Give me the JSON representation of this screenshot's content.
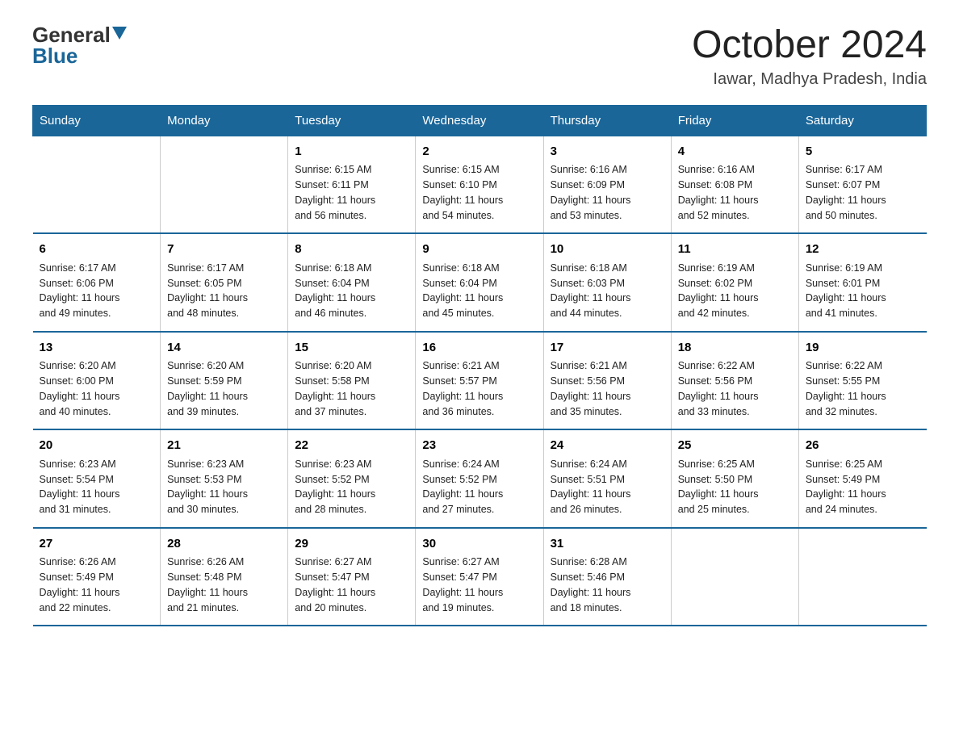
{
  "logo": {
    "general": "General",
    "blue": "Blue"
  },
  "title": "October 2024",
  "location": "Iawar, Madhya Pradesh, India",
  "days_of_week": [
    "Sunday",
    "Monday",
    "Tuesday",
    "Wednesday",
    "Thursday",
    "Friday",
    "Saturday"
  ],
  "weeks": [
    [
      {
        "day": "",
        "info": ""
      },
      {
        "day": "",
        "info": ""
      },
      {
        "day": "1",
        "info": "Sunrise: 6:15 AM\nSunset: 6:11 PM\nDaylight: 11 hours\nand 56 minutes."
      },
      {
        "day": "2",
        "info": "Sunrise: 6:15 AM\nSunset: 6:10 PM\nDaylight: 11 hours\nand 54 minutes."
      },
      {
        "day": "3",
        "info": "Sunrise: 6:16 AM\nSunset: 6:09 PM\nDaylight: 11 hours\nand 53 minutes."
      },
      {
        "day": "4",
        "info": "Sunrise: 6:16 AM\nSunset: 6:08 PM\nDaylight: 11 hours\nand 52 minutes."
      },
      {
        "day": "5",
        "info": "Sunrise: 6:17 AM\nSunset: 6:07 PM\nDaylight: 11 hours\nand 50 minutes."
      }
    ],
    [
      {
        "day": "6",
        "info": "Sunrise: 6:17 AM\nSunset: 6:06 PM\nDaylight: 11 hours\nand 49 minutes."
      },
      {
        "day": "7",
        "info": "Sunrise: 6:17 AM\nSunset: 6:05 PM\nDaylight: 11 hours\nand 48 minutes."
      },
      {
        "day": "8",
        "info": "Sunrise: 6:18 AM\nSunset: 6:04 PM\nDaylight: 11 hours\nand 46 minutes."
      },
      {
        "day": "9",
        "info": "Sunrise: 6:18 AM\nSunset: 6:04 PM\nDaylight: 11 hours\nand 45 minutes."
      },
      {
        "day": "10",
        "info": "Sunrise: 6:18 AM\nSunset: 6:03 PM\nDaylight: 11 hours\nand 44 minutes."
      },
      {
        "day": "11",
        "info": "Sunrise: 6:19 AM\nSunset: 6:02 PM\nDaylight: 11 hours\nand 42 minutes."
      },
      {
        "day": "12",
        "info": "Sunrise: 6:19 AM\nSunset: 6:01 PM\nDaylight: 11 hours\nand 41 minutes."
      }
    ],
    [
      {
        "day": "13",
        "info": "Sunrise: 6:20 AM\nSunset: 6:00 PM\nDaylight: 11 hours\nand 40 minutes."
      },
      {
        "day": "14",
        "info": "Sunrise: 6:20 AM\nSunset: 5:59 PM\nDaylight: 11 hours\nand 39 minutes."
      },
      {
        "day": "15",
        "info": "Sunrise: 6:20 AM\nSunset: 5:58 PM\nDaylight: 11 hours\nand 37 minutes."
      },
      {
        "day": "16",
        "info": "Sunrise: 6:21 AM\nSunset: 5:57 PM\nDaylight: 11 hours\nand 36 minutes."
      },
      {
        "day": "17",
        "info": "Sunrise: 6:21 AM\nSunset: 5:56 PM\nDaylight: 11 hours\nand 35 minutes."
      },
      {
        "day": "18",
        "info": "Sunrise: 6:22 AM\nSunset: 5:56 PM\nDaylight: 11 hours\nand 33 minutes."
      },
      {
        "day": "19",
        "info": "Sunrise: 6:22 AM\nSunset: 5:55 PM\nDaylight: 11 hours\nand 32 minutes."
      }
    ],
    [
      {
        "day": "20",
        "info": "Sunrise: 6:23 AM\nSunset: 5:54 PM\nDaylight: 11 hours\nand 31 minutes."
      },
      {
        "day": "21",
        "info": "Sunrise: 6:23 AM\nSunset: 5:53 PM\nDaylight: 11 hours\nand 30 minutes."
      },
      {
        "day": "22",
        "info": "Sunrise: 6:23 AM\nSunset: 5:52 PM\nDaylight: 11 hours\nand 28 minutes."
      },
      {
        "day": "23",
        "info": "Sunrise: 6:24 AM\nSunset: 5:52 PM\nDaylight: 11 hours\nand 27 minutes."
      },
      {
        "day": "24",
        "info": "Sunrise: 6:24 AM\nSunset: 5:51 PM\nDaylight: 11 hours\nand 26 minutes."
      },
      {
        "day": "25",
        "info": "Sunrise: 6:25 AM\nSunset: 5:50 PM\nDaylight: 11 hours\nand 25 minutes."
      },
      {
        "day": "26",
        "info": "Sunrise: 6:25 AM\nSunset: 5:49 PM\nDaylight: 11 hours\nand 24 minutes."
      }
    ],
    [
      {
        "day": "27",
        "info": "Sunrise: 6:26 AM\nSunset: 5:49 PM\nDaylight: 11 hours\nand 22 minutes."
      },
      {
        "day": "28",
        "info": "Sunrise: 6:26 AM\nSunset: 5:48 PM\nDaylight: 11 hours\nand 21 minutes."
      },
      {
        "day": "29",
        "info": "Sunrise: 6:27 AM\nSunset: 5:47 PM\nDaylight: 11 hours\nand 20 minutes."
      },
      {
        "day": "30",
        "info": "Sunrise: 6:27 AM\nSunset: 5:47 PM\nDaylight: 11 hours\nand 19 minutes."
      },
      {
        "day": "31",
        "info": "Sunrise: 6:28 AM\nSunset: 5:46 PM\nDaylight: 11 hours\nand 18 minutes."
      },
      {
        "day": "",
        "info": ""
      },
      {
        "day": "",
        "info": ""
      }
    ]
  ]
}
